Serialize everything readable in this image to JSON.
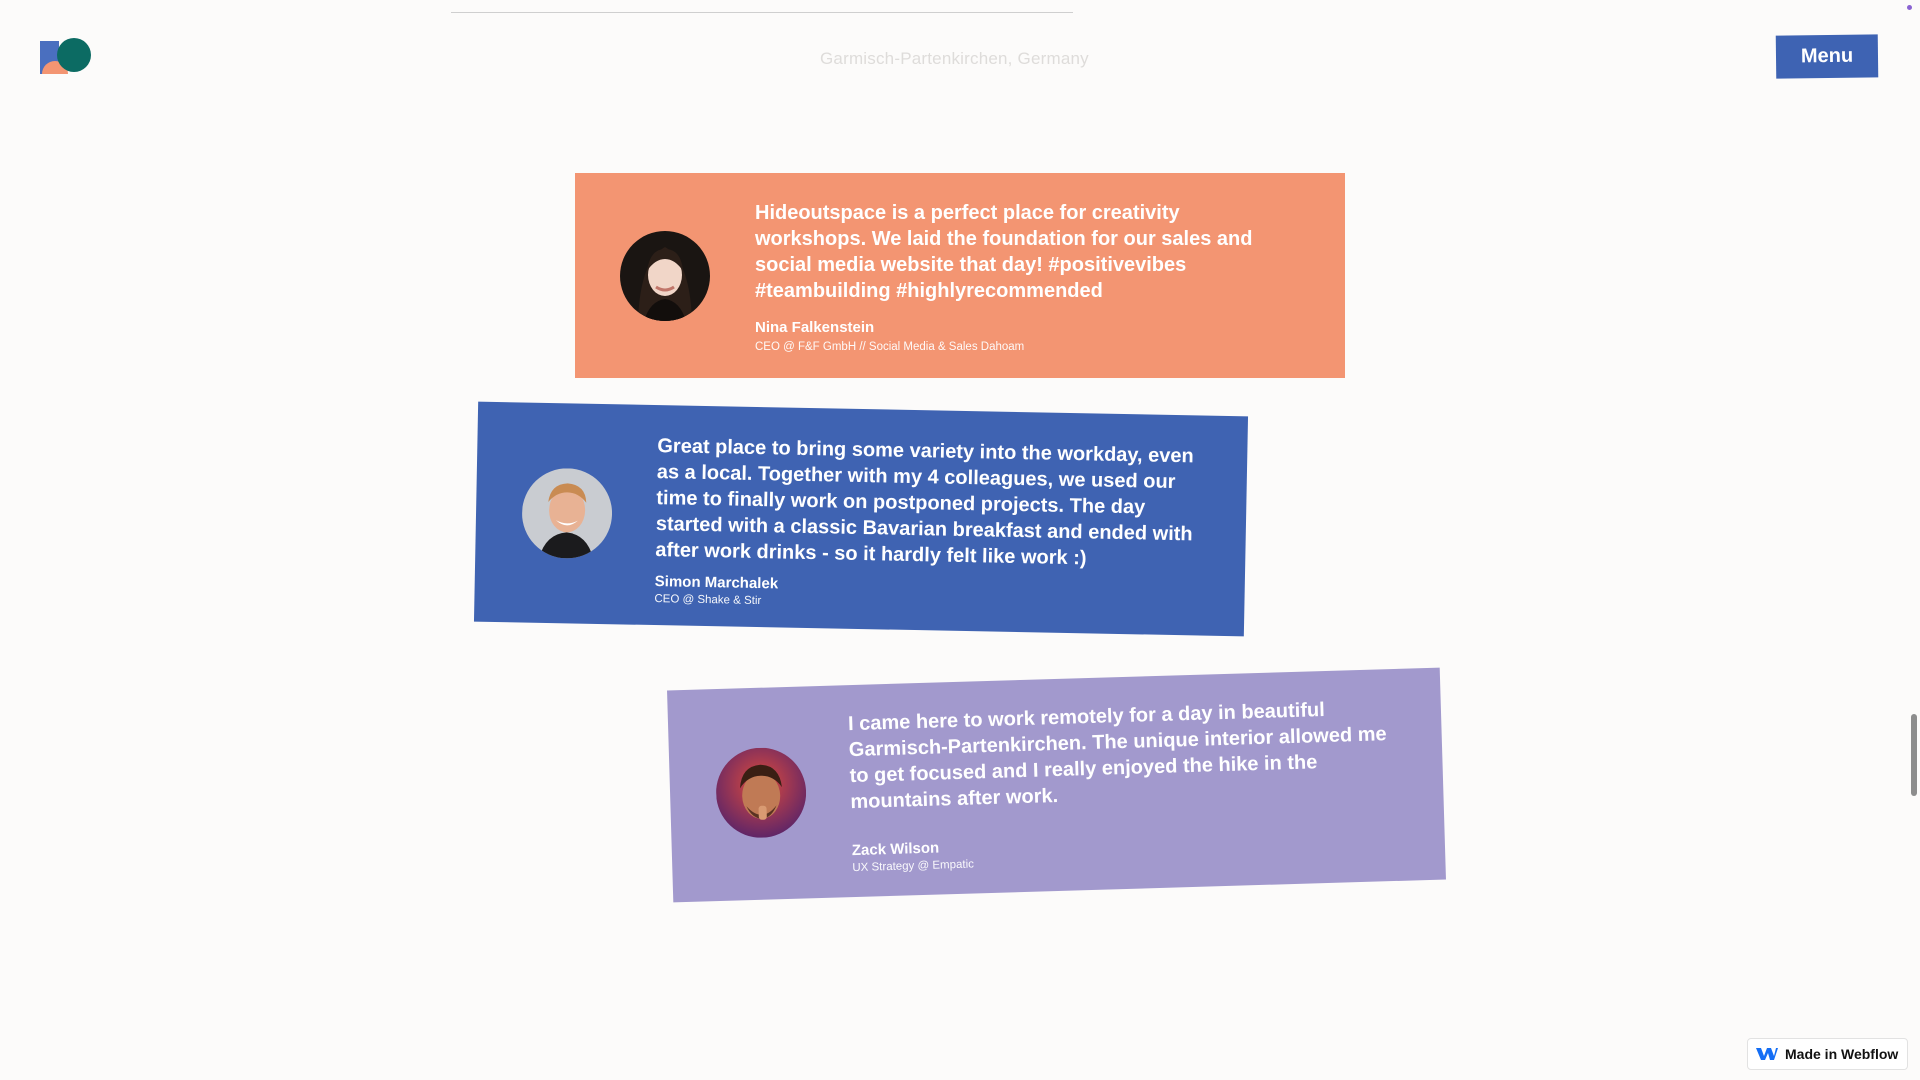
{
  "header": {
    "logo_name": "hideoutspace-logo",
    "location": "Garmisch-Partenkirchen, Germany",
    "menu_label": "Menu"
  },
  "testimonials": [
    {
      "quote": "Hideoutspace is a perfect place for creativity workshops. We laid the foundation for our sales and social media website that day! #positivevibes #teambuilding #highlyrecommended",
      "author": "Nina Falkenstein",
      "role": "CEO @ F&F GmbH // Social Media & Sales Dahoam",
      "color": "#f39572"
    },
    {
      "quote": "Great place to bring some variety into the workday, even as a local. Together with my 4 colleagues, we used our time to finally work on postponed projects. The day started with a classic Bavarian breakfast and ended with after work drinks - so it hardly felt like work :)",
      "author": "Simon Marchalek",
      "role": "CEO @ Shake & Stir",
      "color": "#3f63b2"
    },
    {
      "quote": "I came here to work remotely for a day in beautiful Garmisch-Partenkirchen. The unique interior allowed me to get focused and I really enjoyed the hike in the mountains after work.",
      "author": "Zack Wilson",
      "role": "UX Strategy @ Empatic",
      "color": "#a299cd"
    }
  ],
  "badge": {
    "label": "Made in Webflow",
    "icon": "webflow-icon"
  },
  "colors": {
    "background": "#fcfbfa",
    "menu_button": "#3e63b3",
    "logo_teal": "#0c6b63",
    "logo_blue": "#4a6fbf",
    "logo_orange": "#f39572"
  }
}
